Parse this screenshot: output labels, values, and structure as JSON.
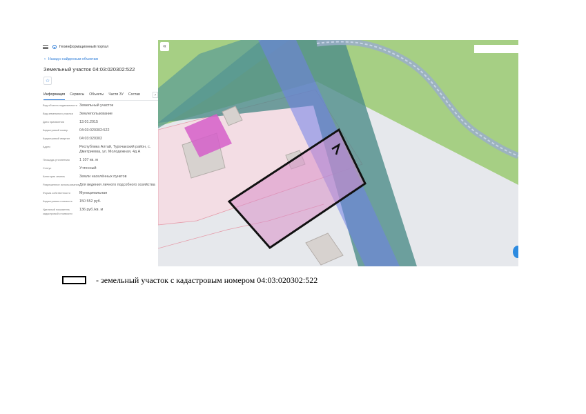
{
  "header": {
    "portal_title": "Геоинформационный портал"
  },
  "navigation": {
    "back_label": "Назад к найденным объектам"
  },
  "parcel": {
    "title": "Земельный участок 04:03:020302:522"
  },
  "tabs": [
    {
      "label": "Информация",
      "active": true
    },
    {
      "label": "Сервисы",
      "active": false
    },
    {
      "label": "Объекты",
      "active": false
    },
    {
      "label": "Части ЗУ",
      "active": false
    },
    {
      "label": "Состав",
      "active": false
    }
  ],
  "attributes": [
    {
      "key": "Вид объекта недвижимости",
      "value": "Земельный участок"
    },
    {
      "key": "Вид земельного участка",
      "value": "Землепользование"
    },
    {
      "key": "Дата присвоения",
      "value": "13.01.2015"
    },
    {
      "key": "Кадастровый номер",
      "value": "04:03:020302:522"
    },
    {
      "key": "Кадастровый квартал",
      "value": "04:03:020302"
    },
    {
      "key": "Адрес",
      "value": "Республика Алтай, Турочакский район, с. Дмитриевка, ул. Молодежная, 4д А"
    },
    {
      "key": "Площадь уточненная",
      "value": "1 107 кв. м"
    },
    {
      "key": "Статус",
      "value": "Учтенный"
    },
    {
      "key": "Категория земель",
      "value": "Земли населённых пунктов"
    },
    {
      "key": "Разрешенное использование",
      "value": "Для ведения личного подсобного хозяйства"
    },
    {
      "key": "Форма собственности",
      "value": "Муниципальная"
    },
    {
      "key": "Кадастровая стоимость",
      "value": "150 552 руб."
    },
    {
      "key": "Удельный показатель кадастровой стоимости",
      "value": "136 руб./кв. м"
    }
  ],
  "map": {
    "collapse_label": "«",
    "colors": {
      "grass": "#a6cf84",
      "road": "#e6e8ec",
      "parcel_fill": "#d98fc8",
      "zone_fill": "#e8a9c0",
      "water_strip": "#4d8c8a",
      "blue_strip": "#6f7fe8"
    }
  },
  "legend": {
    "text": "- земельный участок с кадастровым номером 04:03:020302:522"
  }
}
